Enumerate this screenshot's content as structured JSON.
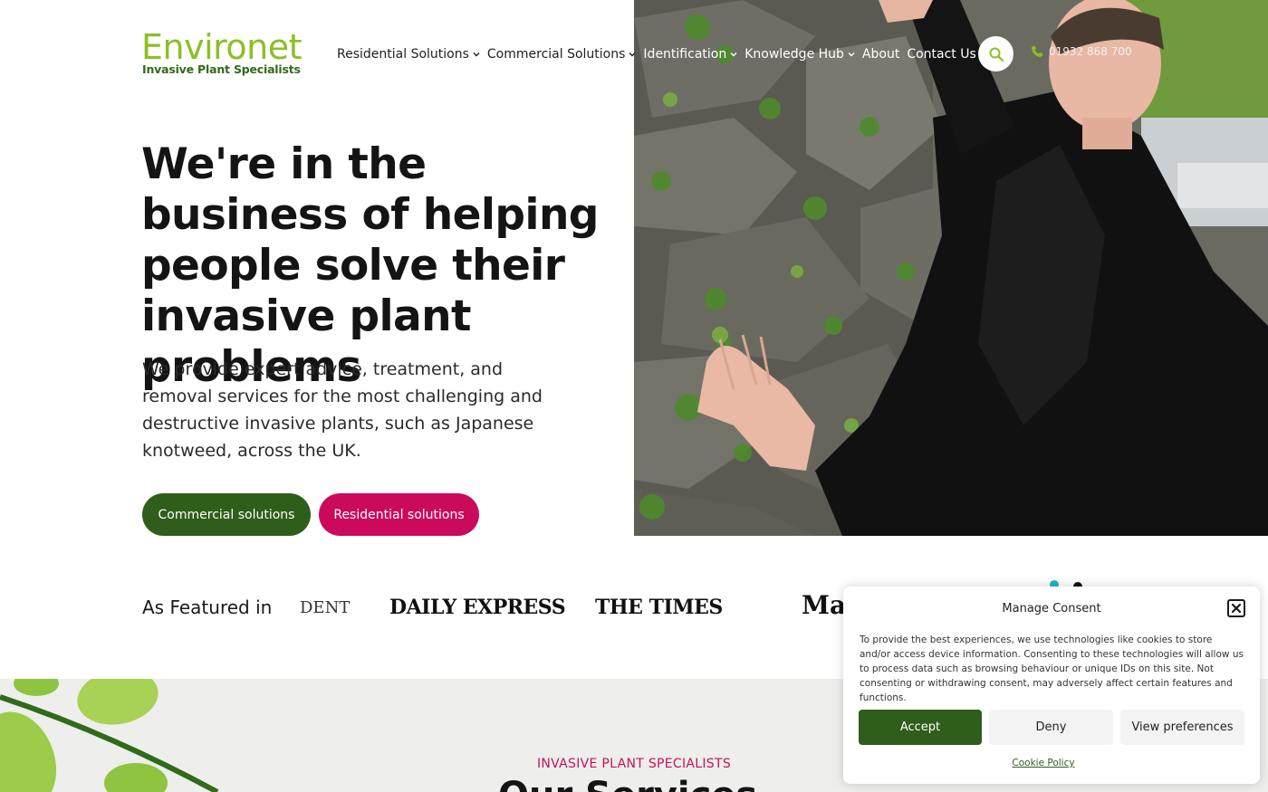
{
  "brand": {
    "name": "Environet",
    "tagline": "Invasive Plant Specialists",
    "colors": {
      "green": "#8cbf26",
      "dark_green": "#2e5e1a",
      "pink": "#cc0a5c"
    }
  },
  "nav": {
    "items": [
      {
        "label": "Residential Solutions",
        "has_dropdown": true
      },
      {
        "label": "Commercial Solutions",
        "has_dropdown": true
      },
      {
        "label": "Identification",
        "has_dropdown": true
      },
      {
        "label": "Knowledge Hub",
        "has_dropdown": true
      },
      {
        "label": "About",
        "has_dropdown": false
      },
      {
        "label": "Contact Us",
        "has_dropdown": false
      }
    ],
    "search_icon": "search-icon",
    "phone": "01932 868 700",
    "phone_icon": "phone-icon"
  },
  "hero": {
    "title": "We're in the business of helping people solve their invasive plant problems",
    "subtitle": "We provide expert advice, treatment, and removal services for the most challenging and destructive invasive plants, such as Japanese knotweed, across the UK.",
    "buttons": {
      "commercial": "Commercial solutions",
      "residential": "Residential solutions"
    }
  },
  "featured": {
    "label": "As Featured in",
    "publications": [
      "DENT",
      "DAILY EXPRESS",
      "THE TIMES",
      "Ma"
    ]
  },
  "services": {
    "kicker": "INVASIVE PLANT SPECIALISTS",
    "heading": "Our Services"
  },
  "consent": {
    "title": "Manage Consent",
    "body": "To provide the best experiences, we use technologies like cookies to store and/or access device information. Consenting to these technologies will allow us to process data such as browsing behaviour or unique IDs on this site. Not consenting or withdrawing consent, may adversely affect certain features and functions.",
    "accept": "Accept",
    "deny": "Deny",
    "preferences": "View preferences",
    "policy_link": "Cookie Policy"
  }
}
